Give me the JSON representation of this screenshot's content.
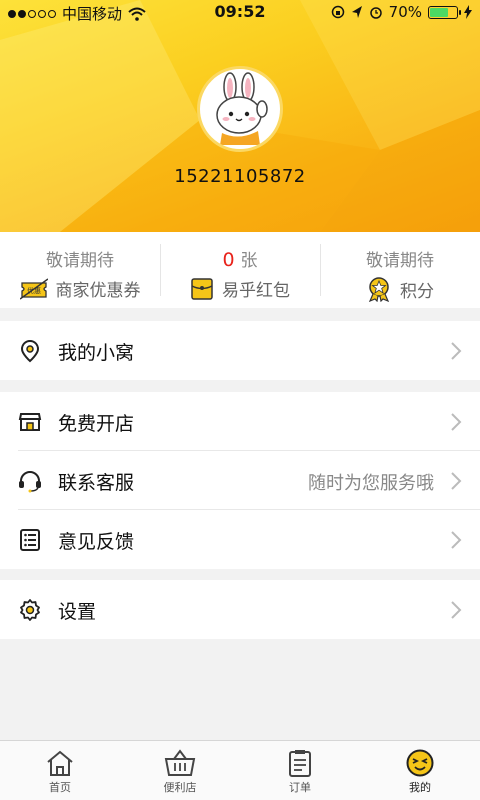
{
  "status_bar": {
    "carrier": "中国移动",
    "time": "09:52",
    "battery": "70%",
    "battery_level": 0.7
  },
  "profile": {
    "phone": "15221105872",
    "avatar_icon": "rabbit-avatar"
  },
  "stats": [
    {
      "top": "敬请期待",
      "label": "商家优惠券",
      "icon": "coupon-icon"
    },
    {
      "count": "0",
      "unit": "张",
      "label": "易乎红包",
      "icon": "red-packet-icon"
    },
    {
      "top": "敬请期待",
      "label": "积分",
      "icon": "medal-icon"
    }
  ],
  "menu": {
    "my_nest": "我的小窝",
    "free_shop": "免费开店",
    "contact_service": "联系客服",
    "contact_service_sub": "随时为您服务哦",
    "feedback": "意见反馈",
    "settings": "设置"
  },
  "tabbar": [
    {
      "label": "首页",
      "icon": "home-icon"
    },
    {
      "label": "便利店",
      "icon": "basket-icon"
    },
    {
      "label": "订单",
      "icon": "order-icon"
    },
    {
      "label": "我的",
      "icon": "smiley-face-icon",
      "active": true
    }
  ],
  "colors": {
    "accent_yellow": "#fbcf20",
    "count_red": "#e8231b"
  }
}
